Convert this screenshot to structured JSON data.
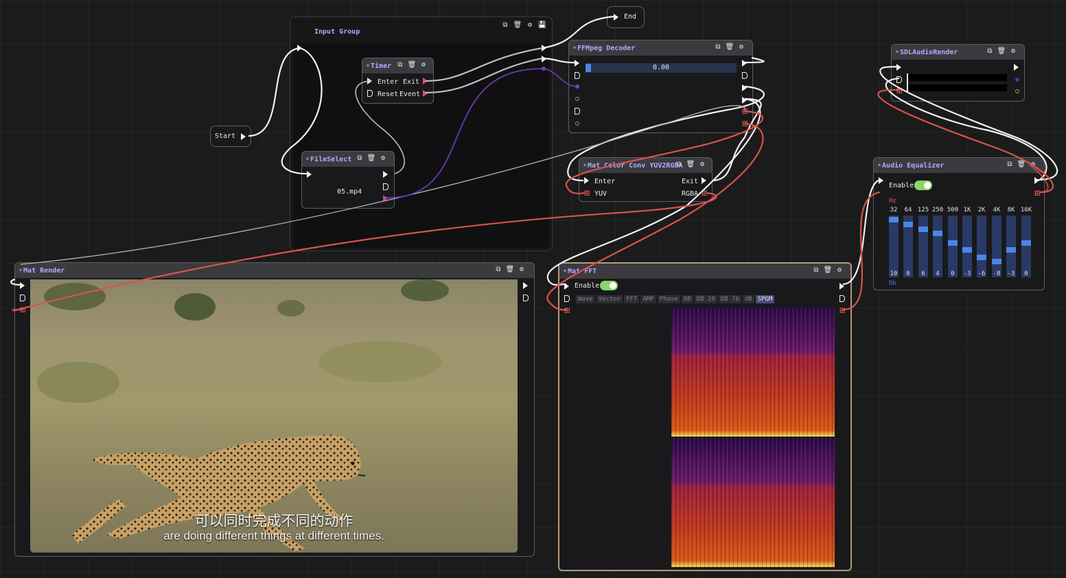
{
  "group": {
    "title": "Input Group"
  },
  "nodes": {
    "start": {
      "label": "Start"
    },
    "end": {
      "label": "End"
    },
    "timer": {
      "title": "Timer",
      "enter": "Enter",
      "exit": "Exit",
      "reset": "Reset",
      "event": "Event"
    },
    "file_select": {
      "title": "FileSelect",
      "file": "05.mp4"
    },
    "ffmpeg": {
      "title": "FFMpeg Decoder",
      "progress_text": "0.00",
      "progress": 0
    },
    "mat_color": {
      "title": "Mat Color Conv YUV2RGBA",
      "enter": "Enter",
      "exit": "Exit",
      "yuv": "YUV",
      "rgba": "RGBA"
    },
    "sdl_audio": {
      "title": "SDLAudioRender"
    },
    "equalizer": {
      "title": "Audio Equalizer",
      "enable_label": "Enable",
      "enabled": true,
      "hz_label": "Hz",
      "db_label": "Db",
      "bands": [
        {
          "freq": "32",
          "gain": "10"
        },
        {
          "freq": "64",
          "gain": "8"
        },
        {
          "freq": "125",
          "gain": "6"
        },
        {
          "freq": "250",
          "gain": "4"
        },
        {
          "freq": "500",
          "gain": "0"
        },
        {
          "freq": "1K",
          "gain": "-3"
        },
        {
          "freq": "2K",
          "gain": "-6"
        },
        {
          "freq": "4K",
          "gain": "-8"
        },
        {
          "freq": "8K",
          "gain": "-3"
        },
        {
          "freq": "16K",
          "gain": "0"
        }
      ]
    },
    "mat_render": {
      "title": "Mat Render",
      "subtitle_cn": "可以同时完成不同的动作",
      "subtitle_en": "are doing different things at different times."
    },
    "mat_fft": {
      "title": "Mat FFT",
      "enable_label": "Enable",
      "enabled": true,
      "tabs": [
        "Wave",
        "Vector",
        "FFT",
        "AMP",
        "Phase",
        "DB",
        "DB 20",
        "DB 76",
        "dB",
        "SPGM"
      ],
      "active_tab": "SPGM"
    }
  },
  "icons": [
    "clone-icon",
    "trash-icon",
    "gear-icon",
    "save-icon",
    "flow-pin-icon",
    "data-pin-icon"
  ],
  "colors": {
    "accent_title": "#b4a8ff",
    "wire_flow": "#f0f0f0",
    "wire_mat": "#d9544a",
    "wire_data": "#7a3fd0",
    "toggle_on": "#8cd66a",
    "eq_thumb": "#4a86e8"
  }
}
